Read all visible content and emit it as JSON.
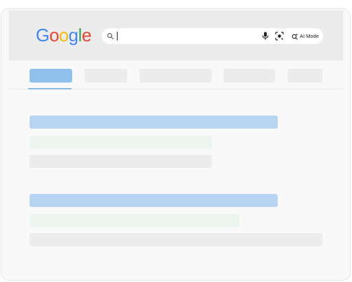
{
  "logo": {
    "letters": [
      {
        "char": "G",
        "color": "#4285F4"
      },
      {
        "char": "o",
        "color": "#EA4335"
      },
      {
        "char": "o",
        "color": "#FBBC05"
      },
      {
        "char": "g",
        "color": "#4285F4"
      },
      {
        "char": "l",
        "color": "#34A853"
      },
      {
        "char": "e",
        "color": "#EA4335"
      }
    ]
  },
  "search": {
    "value": "",
    "icons": [
      "search-icon",
      "mic-icon",
      "lens-icon",
      "ai-mode-icon"
    ],
    "ai_mode_label": "AI Mode"
  },
  "colors": {
    "header_bg": "#ececec",
    "active_tab": "#90c1ec",
    "title_placeholder": "#b7d5f3",
    "url_placeholder": "#edf5ef",
    "snippet_placeholder": "#ececec"
  }
}
